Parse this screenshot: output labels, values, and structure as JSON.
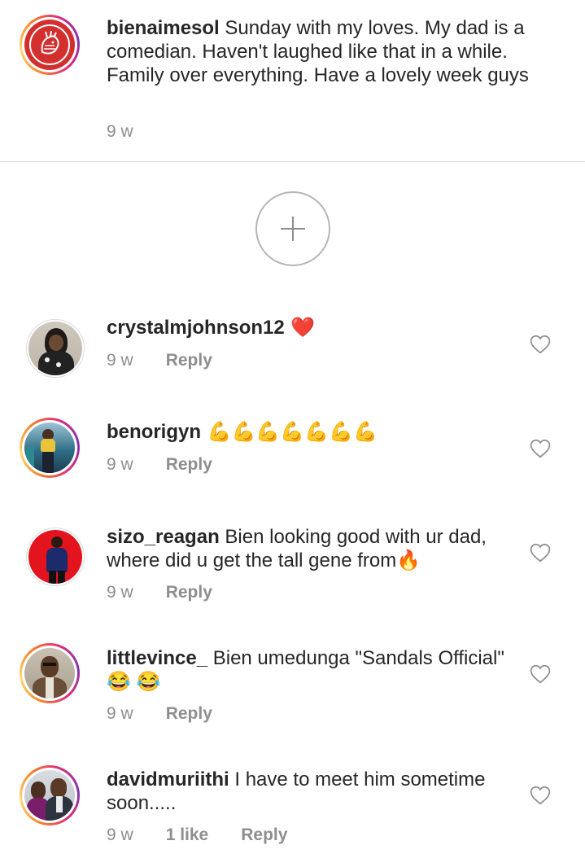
{
  "caption": {
    "username": "bienaimesol",
    "text": " Sunday with my loves. My dad is a comedian. Haven't laughed like that in a while. Family over everything. Have a lovely week guys",
    "time": "9 w"
  },
  "add_button_icon": "plus-icon",
  "comments": [
    {
      "username": "crystalmjohnson12",
      "text": " ❤️",
      "time": "9 w",
      "reply": "Reply"
    },
    {
      "username": "benorigyn",
      "text": " 💪💪💪💪💪💪💪",
      "time": "9 w",
      "reply": "Reply"
    },
    {
      "username": "sizo_reagan",
      "text": " Bien looking good  with ur dad, where did u get the tall gene from🔥",
      "time": "9 w",
      "reply": "Reply"
    },
    {
      "username": "littlevince_",
      "text": " Bien umedunga \"Sandals Official\" 😂 😂",
      "time": "9 w",
      "reply": "Reply"
    },
    {
      "username": "davidmuriithi",
      "text": " I have to meet him sometime soon.....",
      "time": "9 w",
      "likes": "1 like",
      "reply": "Reply"
    }
  ],
  "colors": {
    "brand_red": "#d32f2f",
    "meta_gray": "#8e8e8e",
    "heart_red": "#ed4956"
  }
}
